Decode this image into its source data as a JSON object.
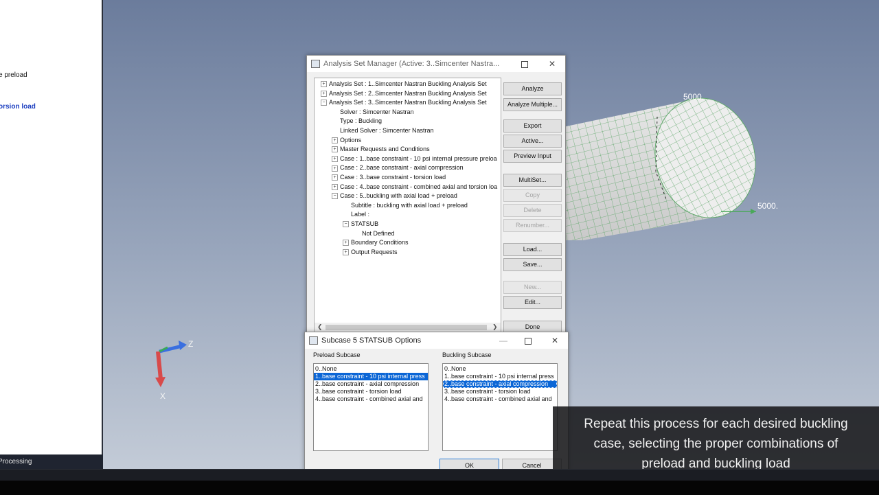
{
  "left_panel": {
    "item_preload": "e preload",
    "item_torsion": "orsion load",
    "status_text": "Processing"
  },
  "viewport": {
    "axis_z_label": "Z",
    "axis_x_label": "X",
    "load_label_top": "5000.",
    "load_label_right": "5000."
  },
  "analysis_set_manager": {
    "title": "Analysis Set Manager (Active: 3..Simcenter Nastra...",
    "tree": [
      {
        "indent": 0,
        "expander": "+",
        "label": "Analysis Set : 1..Simcenter Nastran Buckling Analysis Set"
      },
      {
        "indent": 0,
        "expander": "+",
        "label": "Analysis Set : 2..Simcenter Nastran Buckling Analysis Set"
      },
      {
        "indent": 0,
        "expander": "-",
        "label": "Analysis Set : 3..Simcenter Nastran Buckling Analysis Set"
      },
      {
        "indent": 1,
        "expander": "",
        "label": "Solver : Simcenter Nastran"
      },
      {
        "indent": 1,
        "expander": "",
        "label": "Type : Buckling"
      },
      {
        "indent": 1,
        "expander": "",
        "label": "Linked Solver : Simcenter Nastran"
      },
      {
        "indent": 1,
        "expander": "+",
        "label": "Options"
      },
      {
        "indent": 1,
        "expander": "+",
        "label": "Master Requests and Conditions"
      },
      {
        "indent": 1,
        "expander": "+",
        "label": "Case : 1..base constraint - 10 psi internal pressure preloa"
      },
      {
        "indent": 1,
        "expander": "+",
        "label": "Case : 2..base constraint - axial compression"
      },
      {
        "indent": 1,
        "expander": "+",
        "label": "Case : 3..base constraint - torsion load"
      },
      {
        "indent": 1,
        "expander": "+",
        "label": "Case : 4..base constraint - combined axial and torsion loa"
      },
      {
        "indent": 1,
        "expander": "-",
        "label": "Case : 5..buckling with axial load + preload"
      },
      {
        "indent": 2,
        "expander": "",
        "label": "Subtitle : buckling with axial load + preload"
      },
      {
        "indent": 2,
        "expander": "",
        "label": "Label :"
      },
      {
        "indent": 2,
        "expander": "-",
        "label": "STATSUB"
      },
      {
        "indent": 3,
        "expander": "",
        "label": "Not Defined"
      },
      {
        "indent": 2,
        "expander": "+",
        "label": "Boundary Conditions"
      },
      {
        "indent": 2,
        "expander": "+",
        "label": "Output Requests"
      }
    ],
    "buttons": {
      "analyze": "Analyze",
      "analyze_multiple": "Analyze Multiple...",
      "export": "Export",
      "active": "Active...",
      "preview_input": "Preview Input",
      "multiset": "MultiSet...",
      "copy": "Copy",
      "delete": "Delete",
      "renumber": "Renumber...",
      "load": "Load...",
      "save": "Save...",
      "new": "New...",
      "edit": "Edit...",
      "done": "Done"
    }
  },
  "statsub_dialog": {
    "title": "Subcase 5 STATSUB Options",
    "preload_label": "Preload Subcase",
    "buckling_label": "Buckling Subcase",
    "preload_options": [
      "0..None",
      "1..base constraint - 10 psi internal press",
      "2..base constraint - axial compression",
      "3..base constraint - torsion load",
      "4..base constraint - combined axial and"
    ],
    "preload_selected": 1,
    "buckling_options": [
      "0..None",
      "1..base constraint - 10 psi internal press",
      "2..base constraint - axial compression",
      "3..base constraint - torsion load",
      "4..base constraint - combined axial and"
    ],
    "buckling_selected": 2,
    "ok_label": "OK",
    "cancel_label": "Cancel"
  },
  "caption": {
    "line1": "Repeat this process for each desired buckling",
    "line2": "case, selecting the proper combinations of",
    "line3": "preload and buckling load"
  }
}
